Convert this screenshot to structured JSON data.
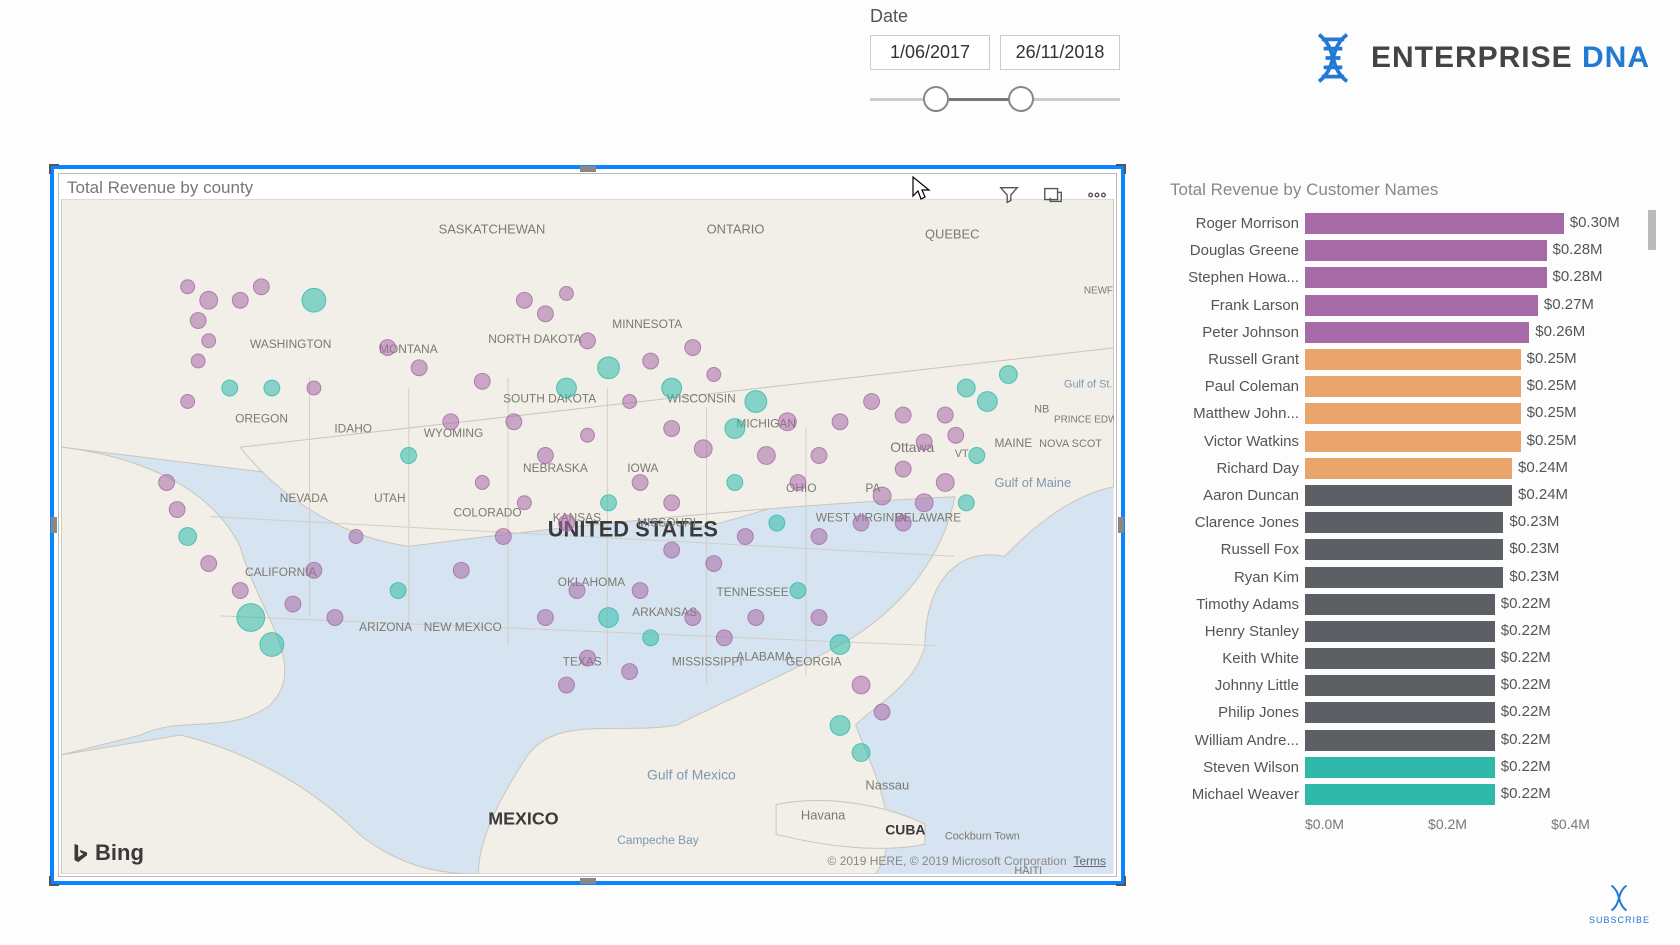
{
  "slicer": {
    "label": "Date",
    "start": "1/06/2017",
    "end": "26/11/2018",
    "handle_start_pct": 26,
    "handle_end_pct": 60
  },
  "logo": {
    "brand_a": "ENTERPRISE ",
    "brand_b": "DNA"
  },
  "subscribe_label": "SUBSCRIBE",
  "map": {
    "title": "Total Revenue by county",
    "bing": "Bing",
    "attribution": "© 2019 HERE, © 2019 Microsoft Corporation",
    "terms": "Terms",
    "labels": {
      "country_us": "UNITED STATES",
      "country_mx": "MEXICO",
      "cuba": "CUBA",
      "gulf_mexico": "Gulf of Mexico",
      "gulf_maine": "Gulf of Maine",
      "campeche": "Campeche Bay",
      "havana": "Havana",
      "nassau": "Nassau",
      "ottawa": "Ottawa",
      "cockburn": "Cockburn Town",
      "gulf_law": "Gulf of St. Lawrence",
      "prince_ed": "PRINCE EDWARD ISLAND",
      "haiti": "HAITI",
      "saskatchewan": "SASKATCHEWAN",
      "ontario": "ONTARIO",
      "quebec": "QUEBEC",
      "nova": "NOVA SCOT",
      "nb": "NB",
      "newf": "NEWF",
      "maine": "MAINE",
      "vt": "VT",
      "washington": "WASHINGTON",
      "montana": "MONTANA",
      "ndakota": "NORTH DAKOTA",
      "minnesota": "MINNESOTA",
      "sdakota": "SOUTH DAKOTA",
      "wisconsin": "WISCONSIN",
      "michigan": "MICHIGAN",
      "oregon": "OREGON",
      "idaho": "IDAHO",
      "wyoming": "WYOMING",
      "nebraska": "NEBRASKA",
      "iowa": "IOWA",
      "ohio": "OHIO",
      "pa": "PA",
      "nevada": "NEVADA",
      "utah": "UTAH",
      "colorado": "COLORADO",
      "kansas": "KANSAS",
      "missouri": "MISSOURI",
      "wvirginia": "WEST VIRGINIA",
      "delaware": "DELAWARE",
      "california": "CALIFORNIA",
      "arizona": "ARIZONA",
      "nmexico": "NEW MEXICO",
      "oklahoma": "OKLAHOMA",
      "arkansas": "ARKANSAS",
      "tennessee": "TENNESSEE",
      "texas": "TEXAS",
      "mississippi": "MISSISSIPPI",
      "alabama": "ALABAMA",
      "georgia": "GEORGIA"
    },
    "bubbles": [
      {
        "x": 14,
        "y": 15,
        "r": 9,
        "c": "#a66aa6"
      },
      {
        "x": 13,
        "y": 18,
        "r": 8,
        "c": "#a66aa6"
      },
      {
        "x": 12,
        "y": 13,
        "r": 7,
        "c": "#a66aa6"
      },
      {
        "x": 17,
        "y": 15,
        "r": 8,
        "c": "#a66aa6"
      },
      {
        "x": 19,
        "y": 13,
        "r": 8,
        "c": "#a66aa6"
      },
      {
        "x": 24,
        "y": 15,
        "r": 12,
        "c": "#2fb9aa"
      },
      {
        "x": 14,
        "y": 21,
        "r": 7,
        "c": "#a66aa6"
      },
      {
        "x": 13,
        "y": 24,
        "r": 7,
        "c": "#a66aa6"
      },
      {
        "x": 16,
        "y": 28,
        "r": 8,
        "c": "#2fb9aa"
      },
      {
        "x": 20,
        "y": 28,
        "r": 8,
        "c": "#2fb9aa"
      },
      {
        "x": 12,
        "y": 30,
        "r": 7,
        "c": "#a66aa6"
      },
      {
        "x": 24,
        "y": 28,
        "r": 7,
        "c": "#a66aa6"
      },
      {
        "x": 31,
        "y": 22,
        "r": 8,
        "c": "#a66aa6"
      },
      {
        "x": 34,
        "y": 25,
        "r": 8,
        "c": "#a66aa6"
      },
      {
        "x": 37,
        "y": 33,
        "r": 8,
        "c": "#a66aa6"
      },
      {
        "x": 33,
        "y": 38,
        "r": 8,
        "c": "#2fb9aa"
      },
      {
        "x": 44,
        "y": 15,
        "r": 8,
        "c": "#a66aa6"
      },
      {
        "x": 46,
        "y": 17,
        "r": 8,
        "c": "#a66aa6"
      },
      {
        "x": 48,
        "y": 14,
        "r": 7,
        "c": "#a66aa6"
      },
      {
        "x": 50,
        "y": 21,
        "r": 8,
        "c": "#a66aa6"
      },
      {
        "x": 52,
        "y": 25,
        "r": 11,
        "c": "#2fb9aa"
      },
      {
        "x": 48,
        "y": 28,
        "r": 10,
        "c": "#2fb9aa"
      },
      {
        "x": 40,
        "y": 27,
        "r": 8,
        "c": "#a66aa6"
      },
      {
        "x": 43,
        "y": 33,
        "r": 8,
        "c": "#a66aa6"
      },
      {
        "x": 46,
        "y": 38,
        "r": 8,
        "c": "#a66aa6"
      },
      {
        "x": 50,
        "y": 35,
        "r": 7,
        "c": "#a66aa6"
      },
      {
        "x": 54,
        "y": 30,
        "r": 7,
        "c": "#a66aa6"
      },
      {
        "x": 56,
        "y": 24,
        "r": 8,
        "c": "#a66aa6"
      },
      {
        "x": 58,
        "y": 28,
        "r": 10,
        "c": "#2fb9aa"
      },
      {
        "x": 60,
        "y": 22,
        "r": 8,
        "c": "#a66aa6"
      },
      {
        "x": 62,
        "y": 26,
        "r": 7,
        "c": "#a66aa6"
      },
      {
        "x": 58,
        "y": 34,
        "r": 8,
        "c": "#a66aa6"
      },
      {
        "x": 61,
        "y": 37,
        "r": 9,
        "c": "#a66aa6"
      },
      {
        "x": 64,
        "y": 34,
        "r": 10,
        "c": "#2fb9aa"
      },
      {
        "x": 66,
        "y": 30,
        "r": 11,
        "c": "#2fb9aa"
      },
      {
        "x": 69,
        "y": 33,
        "r": 9,
        "c": "#a66aa6"
      },
      {
        "x": 67,
        "y": 38,
        "r": 9,
        "c": "#a66aa6"
      },
      {
        "x": 64,
        "y": 42,
        "r": 8,
        "c": "#2fb9aa"
      },
      {
        "x": 70,
        "y": 42,
        "r": 8,
        "c": "#a66aa6"
      },
      {
        "x": 72,
        "y": 38,
        "r": 8,
        "c": "#a66aa6"
      },
      {
        "x": 74,
        "y": 33,
        "r": 8,
        "c": "#a66aa6"
      },
      {
        "x": 77,
        "y": 30,
        "r": 8,
        "c": "#a66aa6"
      },
      {
        "x": 80,
        "y": 32,
        "r": 8,
        "c": "#a66aa6"
      },
      {
        "x": 82,
        "y": 36,
        "r": 8,
        "c": "#a66aa6"
      },
      {
        "x": 84,
        "y": 32,
        "r": 8,
        "c": "#a66aa6"
      },
      {
        "x": 86,
        "y": 28,
        "r": 9,
        "c": "#2fb9aa"
      },
      {
        "x": 88,
        "y": 30,
        "r": 10,
        "c": "#2fb9aa"
      },
      {
        "x": 85,
        "y": 35,
        "r": 8,
        "c": "#a66aa6"
      },
      {
        "x": 87,
        "y": 38,
        "r": 8,
        "c": "#2fb9aa"
      },
      {
        "x": 80,
        "y": 40,
        "r": 8,
        "c": "#a66aa6"
      },
      {
        "x": 78,
        "y": 44,
        "r": 9,
        "c": "#a66aa6"
      },
      {
        "x": 82,
        "y": 45,
        "r": 9,
        "c": "#a66aa6"
      },
      {
        "x": 76,
        "y": 48,
        "r": 8,
        "c": "#a66aa6"
      },
      {
        "x": 72,
        "y": 50,
        "r": 8,
        "c": "#a66aa6"
      },
      {
        "x": 68,
        "y": 48,
        "r": 8,
        "c": "#2fb9aa"
      },
      {
        "x": 65,
        "y": 50,
        "r": 8,
        "c": "#a66aa6"
      },
      {
        "x": 62,
        "y": 54,
        "r": 8,
        "c": "#a66aa6"
      },
      {
        "x": 58,
        "y": 52,
        "r": 8,
        "c": "#a66aa6"
      },
      {
        "x": 55,
        "y": 58,
        "r": 8,
        "c": "#a66aa6"
      },
      {
        "x": 52,
        "y": 62,
        "r": 10,
        "c": "#2fb9aa"
      },
      {
        "x": 49,
        "y": 58,
        "r": 8,
        "c": "#a66aa6"
      },
      {
        "x": 46,
        "y": 62,
        "r": 8,
        "c": "#a66aa6"
      },
      {
        "x": 50,
        "y": 68,
        "r": 8,
        "c": "#a66aa6"
      },
      {
        "x": 54,
        "y": 70,
        "r": 8,
        "c": "#a66aa6"
      },
      {
        "x": 48,
        "y": 72,
        "r": 8,
        "c": "#a66aa6"
      },
      {
        "x": 56,
        "y": 65,
        "r": 8,
        "c": "#2fb9aa"
      },
      {
        "x": 60,
        "y": 62,
        "r": 8,
        "c": "#a66aa6"
      },
      {
        "x": 63,
        "y": 65,
        "r": 8,
        "c": "#a66aa6"
      },
      {
        "x": 66,
        "y": 62,
        "r": 8,
        "c": "#a66aa6"
      },
      {
        "x": 70,
        "y": 58,
        "r": 8,
        "c": "#2fb9aa"
      },
      {
        "x": 72,
        "y": 62,
        "r": 8,
        "c": "#a66aa6"
      },
      {
        "x": 74,
        "y": 66,
        "r": 10,
        "c": "#2fb9aa"
      },
      {
        "x": 76,
        "y": 72,
        "r": 9,
        "c": "#a66aa6"
      },
      {
        "x": 74,
        "y": 78,
        "r": 10,
        "c": "#2fb9aa"
      },
      {
        "x": 76,
        "y": 82,
        "r": 9,
        "c": "#2fb9aa"
      },
      {
        "x": 78,
        "y": 76,
        "r": 8,
        "c": "#a66aa6"
      },
      {
        "x": 10,
        "y": 42,
        "r": 8,
        "c": "#a66aa6"
      },
      {
        "x": 11,
        "y": 46,
        "r": 8,
        "c": "#a66aa6"
      },
      {
        "x": 12,
        "y": 50,
        "r": 9,
        "c": "#2fb9aa"
      },
      {
        "x": 14,
        "y": 54,
        "r": 8,
        "c": "#a66aa6"
      },
      {
        "x": 17,
        "y": 58,
        "r": 8,
        "c": "#a66aa6"
      },
      {
        "x": 18,
        "y": 62,
        "r": 14,
        "c": "#2fb9aa"
      },
      {
        "x": 20,
        "y": 66,
        "r": 12,
        "c": "#2fb9aa"
      },
      {
        "x": 22,
        "y": 60,
        "r": 8,
        "c": "#a66aa6"
      },
      {
        "x": 24,
        "y": 55,
        "r": 8,
        "c": "#a66aa6"
      },
      {
        "x": 28,
        "y": 50,
        "r": 7,
        "c": "#a66aa6"
      },
      {
        "x": 32,
        "y": 58,
        "r": 8,
        "c": "#2fb9aa"
      },
      {
        "x": 26,
        "y": 62,
        "r": 8,
        "c": "#a66aa6"
      },
      {
        "x": 38,
        "y": 55,
        "r": 8,
        "c": "#a66aa6"
      },
      {
        "x": 42,
        "y": 50,
        "r": 8,
        "c": "#a66aa6"
      },
      {
        "x": 44,
        "y": 45,
        "r": 7,
        "c": "#a66aa6"
      },
      {
        "x": 40,
        "y": 42,
        "r": 7,
        "c": "#a66aa6"
      },
      {
        "x": 48,
        "y": 48,
        "r": 8,
        "c": "#a66aa6"
      },
      {
        "x": 52,
        "y": 45,
        "r": 8,
        "c": "#2fb9aa"
      },
      {
        "x": 55,
        "y": 42,
        "r": 8,
        "c": "#a66aa6"
      },
      {
        "x": 58,
        "y": 45,
        "r": 8,
        "c": "#a66aa6"
      },
      {
        "x": 84,
        "y": 42,
        "r": 9,
        "c": "#a66aa6"
      },
      {
        "x": 86,
        "y": 45,
        "r": 8,
        "c": "#2fb9aa"
      },
      {
        "x": 80,
        "y": 48,
        "r": 8,
        "c": "#a66aa6"
      },
      {
        "x": 90,
        "y": 26,
        "r": 9,
        "c": "#2fb9aa"
      }
    ]
  },
  "chart_data": {
    "type": "bar",
    "title": "Total Revenue by Customer Names",
    "xlabel": "",
    "ylabel": "",
    "xlim": [
      0,
      0.4
    ],
    "x_ticks": [
      "$0.0M",
      "$0.2M",
      "$0.4M"
    ],
    "value_unit": "M",
    "categories": [
      "Roger Morrison",
      "Douglas Greene",
      "Stephen Howa...",
      "Frank Larson",
      "Peter Johnson",
      "Russell Grant",
      "Paul Coleman",
      "Matthew John...",
      "Victor Watkins",
      "Richard Day",
      "Aaron Duncan",
      "Clarence Jones",
      "Russell Fox",
      "Ryan Kim",
      "Timothy Adams",
      "Henry Stanley",
      "Keith White",
      "Johnny Little",
      "Philip Jones",
      "William Andre...",
      "Steven Wilson",
      "Michael Weaver"
    ],
    "values": [
      0.3,
      0.28,
      0.28,
      0.27,
      0.26,
      0.25,
      0.25,
      0.25,
      0.25,
      0.24,
      0.24,
      0.23,
      0.23,
      0.23,
      0.22,
      0.22,
      0.22,
      0.22,
      0.22,
      0.22,
      0.22,
      0.22
    ],
    "value_labels": [
      "$0.30M",
      "$0.28M",
      "$0.28M",
      "$0.27M",
      "$0.26M",
      "$0.25M",
      "$0.25M",
      "$0.25M",
      "$0.25M",
      "$0.24M",
      "$0.24M",
      "$0.23M",
      "$0.23M",
      "$0.23M",
      "$0.22M",
      "$0.22M",
      "$0.22M",
      "$0.22M",
      "$0.22M",
      "$0.22M",
      "$0.22M",
      "$0.22M"
    ],
    "colors": [
      "#a66aa6",
      "#a66aa6",
      "#a66aa6",
      "#a66aa6",
      "#a66aa6",
      "#e8a46b",
      "#e8a46b",
      "#e8a46b",
      "#e8a46b",
      "#e8a46b",
      "#5c6064",
      "#5c6064",
      "#5c6064",
      "#5c6064",
      "#5c6064",
      "#5c6064",
      "#5c6064",
      "#5c6064",
      "#5c6064",
      "#5c6064",
      "#2fb9aa",
      "#2fb9aa"
    ]
  }
}
